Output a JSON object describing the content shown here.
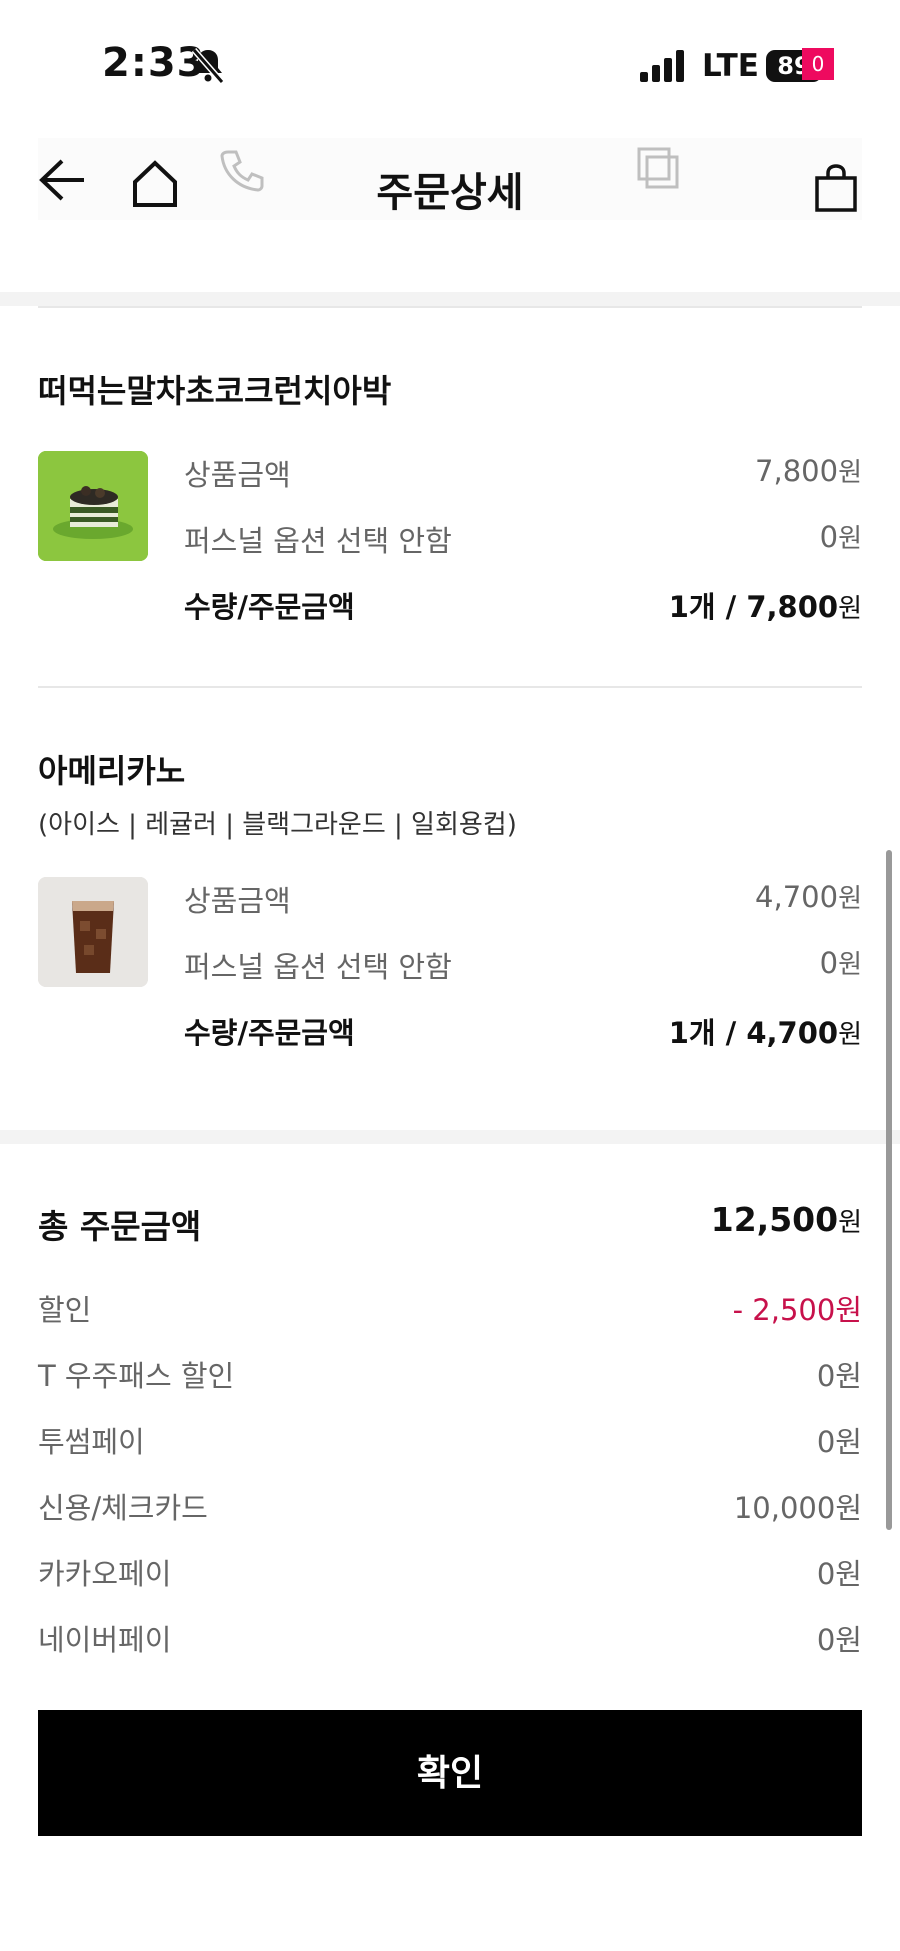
{
  "status_bar": {
    "time": "2:33",
    "network": "LTE",
    "battery": "89"
  },
  "header": {
    "title": "주문상세",
    "cart_count": "0"
  },
  "items": [
    {
      "name": "떠먹는말차초코크런치아박",
      "options": "",
      "rows": [
        {
          "label": "상품금액",
          "value": "7,800",
          "unit": "원"
        },
        {
          "label": "퍼스널 옵션 선택 안함",
          "value": "0",
          "unit": "원"
        },
        {
          "label": "수량/주문금액",
          "value": "1개  / 7,800",
          "unit": "원"
        }
      ]
    },
    {
      "name": "아메리카노",
      "options": "(아이스 | 레귤러 | 블랙그라운드 | 일회용컵)",
      "rows": [
        {
          "label": "상품금액",
          "value": "4,700",
          "unit": "원"
        },
        {
          "label": "퍼스널 옵션 선택 안함",
          "value": "0",
          "unit": "원"
        },
        {
          "label": "수량/주문금액",
          "value": "1개  / 4,700",
          "unit": "원"
        }
      ]
    }
  ],
  "summary": {
    "total_label": "총 주문금액",
    "total_value": "12,500",
    "total_unit": "원",
    "rows": [
      {
        "label": "할인",
        "value": "- 2,500원"
      },
      {
        "label": "T 우주패스 할인",
        "value": "0원"
      },
      {
        "label": "투썸페이",
        "value": "0원"
      },
      {
        "label": "신용/체크카드",
        "value": "10,000원"
      },
      {
        "label": "카카오페이",
        "value": "0원"
      },
      {
        "label": "네이버페이",
        "value": "0원"
      }
    ]
  },
  "confirm_label": "확인",
  "colors": {
    "badge": "#ee0a5f",
    "discount": "#c7114b",
    "button": "#000000"
  }
}
